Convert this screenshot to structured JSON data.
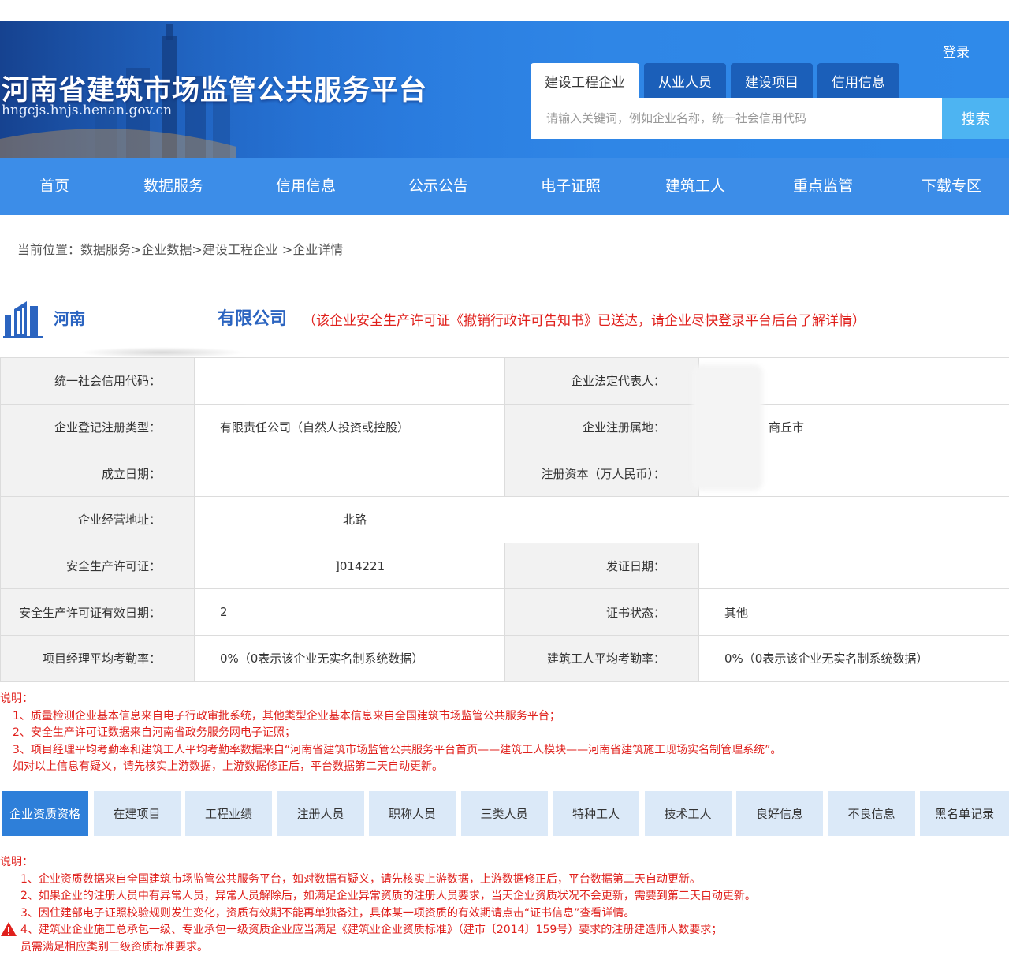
{
  "header": {
    "title": "河南省建筑市场监管公共服务平台",
    "url": "hngcjs.hnjs.henan.gov.cn",
    "login": "登录",
    "search_tabs": [
      "建设工程企业",
      "从业人员",
      "建设项目",
      "信用信息"
    ],
    "search_placeholder": "请输入关键词，例如企业名称，统一社会信用代码",
    "search_button": "搜索"
  },
  "nav": {
    "items": [
      "首页",
      "数据服务",
      "信用信息",
      "公示公告",
      "电子证照",
      "建筑工人",
      "重点监管",
      "下载专区"
    ]
  },
  "breadcrumb": "当前位置：数据服务>企业数据>建设工程企业 >企业详情",
  "company": {
    "name_prefix": "河南",
    "name_suffix": "有限公司",
    "warning": "（该企业安全生产许可证《撤销行政许可告知书》已送达，请企业尽快登录平台后台了解详情）"
  },
  "info": {
    "rows": [
      {
        "label1": "统一社会信用代码：",
        "value1": "",
        "label2": "企业法定代表人：",
        "value2": ""
      },
      {
        "label1": "企业登记注册类型：",
        "value1": "有限责任公司（自然人投资或控股）",
        "label2": "企业注册属地：",
        "value2": "商丘市"
      },
      {
        "label1": "成立日期：",
        "value1": "",
        "label2": "注册资本（万人民币）：",
        "value2": ""
      },
      {
        "label1": "企业经营地址：",
        "value1": "北路",
        "label2": "",
        "value2": ""
      },
      {
        "label1": "安全生产许可证：",
        "value1": "]014221",
        "label2": "发证日期：",
        "value2": ""
      },
      {
        "label1": "安全生产许可证有效日期：",
        "value1": "2",
        "label2": "证书状态：",
        "value2": "其他"
      },
      {
        "label1": "项目经理平均考勤率：",
        "value1": "0%（0表示该企业无实名制系统数据）",
        "label2": "建筑工人平均考勤率：",
        "value2": "0%（0表示该企业无实名制系统数据）"
      }
    ]
  },
  "notes1": {
    "head": "说明：",
    "lines": [
      "1、质量检测企业基本信息来自电子行政审批系统，其他类型企业基本信息来自全国建筑市场监管公共服务平台；",
      "2、安全生产许可证数据来自河南省政务服务网电子证照；",
      "3、项目经理平均考勤率和建筑工人平均考勤率数据来自“河南省建筑市场监管公共服务平台首页——建筑工人模块——河南省建筑施工现场实名制管理系统”。",
      "如对以上信息有疑义，请先核实上游数据，上游数据修正后，平台数据第二天自动更新。"
    ]
  },
  "tabs": [
    "企业资质资格",
    "在建项目",
    "工程业绩",
    "注册人员",
    "职称人员",
    "三类人员",
    "特种工人",
    "技术工人",
    "良好信息",
    "不良信息",
    "黑名单记录"
  ],
  "notes2": {
    "head": "说明：",
    "lines": [
      "1、企业资质数据来自全国建筑市场监管公共服务平台，如对数据有疑义，请先核实上游数据，上游数据修正后，平台数据第二天自动更新。",
      "2、如果企业的注册人员中有异常人员，异常人员解除后，如满足企业异常资质的注册人员要求，当天企业资质状况不会更新，需要到第二天自动更新。",
      "3、因住建部电子证照校验规则发生变化，资质有效期不能再单独备注，具体某一项资质的有效期请点击“证书信息”查看详情。",
      "4、建筑业企业施工总承包一级、专业承包一级资质企业应当满足《建筑业企业资质标准》（建市〔2014〕159号）要求的注册建造师人数要求；",
      "员需满足相应类别三级资质标准要求。"
    ]
  },
  "colors": {
    "header_blue": "#2878dc",
    "nav_blue": "#3c8de8",
    "company_blue": "#2b64c0",
    "warning_red": "#e0201c",
    "tab_active": "#2e7fd9",
    "tab_inactive": "#dbe9f8"
  }
}
